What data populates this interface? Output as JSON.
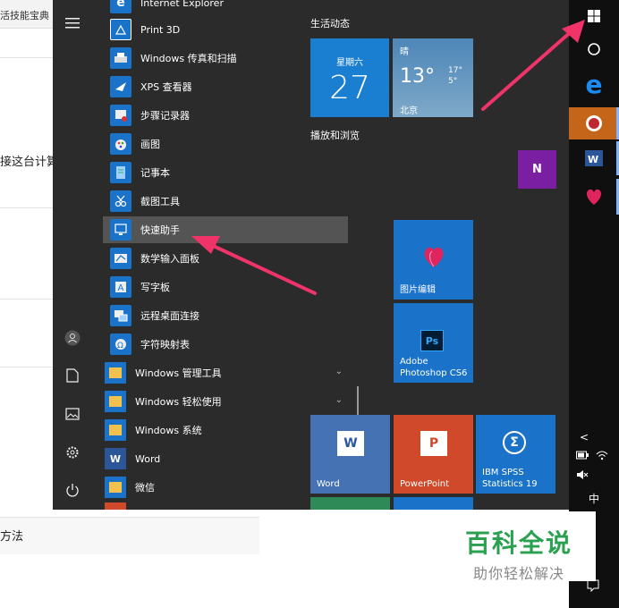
{
  "background_page": {
    "tab_title": "活技能宝典",
    "text_1": "接这台计算",
    "text_2": "方法"
  },
  "start_menu": {
    "rail": [
      "hamburger-icon",
      "user-icon",
      "document-icon",
      "pictures-icon",
      "settings-icon",
      "power-icon"
    ],
    "apps": [
      {
        "label": "Internet Explorer"
      },
      {
        "label": "Print 3D"
      },
      {
        "label": "Windows 传真和扫描"
      },
      {
        "label": "XPS 查看器"
      },
      {
        "label": "步骤记录器"
      },
      {
        "label": "画图"
      },
      {
        "label": "记事本"
      },
      {
        "label": "截图工具"
      },
      {
        "label": "快速助手"
      },
      {
        "label": "数学输入面板"
      },
      {
        "label": "写字板"
      },
      {
        "label": "远程桌面连接"
      },
      {
        "label": "字符映射表"
      },
      {
        "label": "Windows 管理工具"
      },
      {
        "label": "Windows 轻松使用"
      },
      {
        "label": "Windows 系统"
      },
      {
        "label": "Word"
      },
      {
        "label": "微信"
      }
    ],
    "tiles": {
      "group_1": "生活动态",
      "group_2": "播放和浏览",
      "calendar": {
        "weekday": "星期六",
        "day": "27"
      },
      "weather": {
        "condition": "晴",
        "temp": "13°",
        "high": "17°",
        "low": "5°",
        "city": "北京"
      },
      "onenote_letter": "N",
      "photo_editor": "图片编辑",
      "photoshop": {
        "badge": "Ps",
        "label": "Adobe Photoshop CS6"
      },
      "word": {
        "label": "Word",
        "badge": "W"
      },
      "powerpoint": {
        "label": "PowerPoint",
        "badge": "P"
      },
      "spss": {
        "label": "IBM SPSS Statistics 19",
        "badge": "Σ"
      }
    }
  },
  "tray": {
    "ime": "中"
  },
  "watermark": {
    "main": "百科全说",
    "sub": "助你轻松解决"
  },
  "colors": {
    "start_bg": "#2b2b2b",
    "tile_blue": "#1a73c9",
    "arrow": "#f0346a",
    "watermark_green": "#2aa050"
  }
}
